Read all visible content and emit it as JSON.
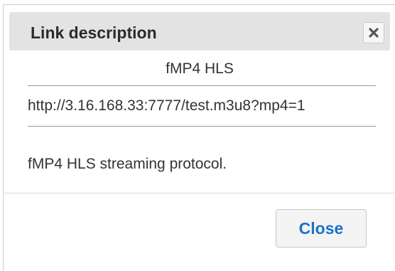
{
  "dialog": {
    "title": "Link description",
    "close_icon": "close-icon",
    "heading": "fMP4 HLS",
    "url": "http://3.16.168.33:7777/test.m3u8?mp4=1",
    "description": "fMP4 HLS streaming protocol.",
    "close_label": "Close"
  },
  "colors": {
    "titlebar": "#e3e3e3",
    "button_text": "#1a73c9",
    "text": "#333333"
  }
}
